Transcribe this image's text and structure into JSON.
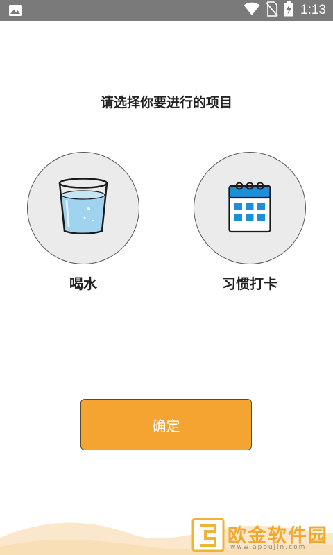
{
  "status_bar": {
    "time": "1:13",
    "icons": [
      "image-icon",
      "wifi-icon",
      "no-sim-icon",
      "battery-charging-icon"
    ]
  },
  "main": {
    "title": "请选择你要进行的项目",
    "options": [
      {
        "label": "喝水",
        "icon": "water-glass-icon"
      },
      {
        "label": "习惯打卡",
        "icon": "calendar-icon"
      }
    ],
    "confirm_label": "确定"
  },
  "watermark": {
    "text": "欧金软件园",
    "url": "www.apoujin.com"
  },
  "colors": {
    "accent": "#f4a431",
    "status_bar": "#7a7a7a",
    "circle_bg": "#ebebeb",
    "water": "#9fd3ef",
    "calendar_blue": "#1d8fd6"
  }
}
